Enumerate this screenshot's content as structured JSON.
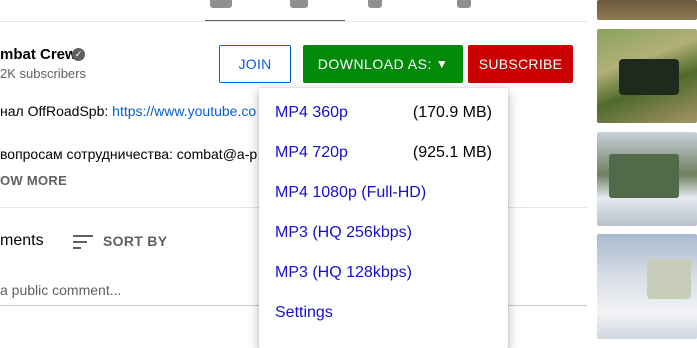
{
  "channel": {
    "name": "mbat Crew",
    "subscribers": "2K subscribers"
  },
  "buttons": {
    "join": "JOIN",
    "download": "DOWNLOAD AS:",
    "download_arrow": "▼",
    "subscribe": "SUBSCRIBE"
  },
  "description": {
    "line1_prefix": "нал OffRoadSpb: ",
    "line1_link": "https://www.youtube.co",
    "line2": "вопросам сотрудничества: combat@a-p",
    "show_more": "OW MORE"
  },
  "comments": {
    "title": "ments",
    "sort_by": "SORT BY",
    "placeholder": "a public comment..."
  },
  "download_menu": {
    "items": [
      {
        "label": "MP4 360p",
        "size": "(170.9 MB)"
      },
      {
        "label": "MP4 720p",
        "size": "(925.1 MB)"
      },
      {
        "label": "MP4 1080p (Full-HD)",
        "size": ""
      },
      {
        "label": "MP3 (HQ 256kbps)",
        "size": ""
      },
      {
        "label": "MP3 (HQ 128kbps)",
        "size": ""
      },
      {
        "label": "Settings",
        "size": ""
      }
    ]
  },
  "colors": {
    "download_bg": "#038a0b",
    "subscribe_bg": "#cc0000",
    "link": "#065fd4",
    "menu_item": "#1a0dcc"
  }
}
